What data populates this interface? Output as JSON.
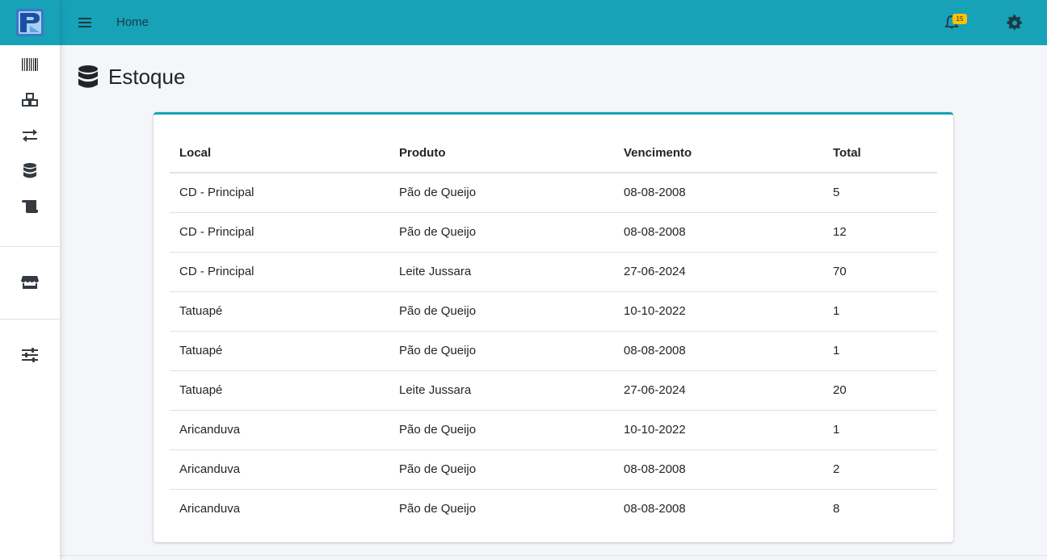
{
  "topbar": {
    "home_label": "Home",
    "notification_count": "15"
  },
  "page": {
    "title": "Estoque"
  },
  "table": {
    "headers": [
      "Local",
      "Produto",
      "Vencimento",
      "Total"
    ],
    "rows": [
      [
        "CD - Principal",
        "Pão de Queijo",
        "08-08-2008",
        "5"
      ],
      [
        "CD - Principal",
        "Pão de Queijo",
        "08-08-2008",
        "12"
      ],
      [
        "CD - Principal",
        "Leite Jussara",
        "27-06-2024",
        "70"
      ],
      [
        "Tatuapé",
        "Pão de Queijo",
        "10-10-2022",
        "1"
      ],
      [
        "Tatuapé",
        "Pão de Queijo",
        "08-08-2008",
        "1"
      ],
      [
        "Tatuapé",
        "Leite Jussara",
        "27-06-2024",
        "20"
      ],
      [
        "Aricanduva",
        "Pão de Queijo",
        "10-10-2022",
        "1"
      ],
      [
        "Aricanduva",
        "Pão de Queijo",
        "08-08-2008",
        "2"
      ],
      [
        "Aricanduva",
        "Pão de Queijo",
        "08-08-2008",
        "8"
      ]
    ]
  },
  "sidebar": {
    "icons": [
      "barcode-icon",
      "boxes-icon",
      "exchange-icon",
      "database-icon",
      "scroll-icon",
      "store-icon",
      "sliders-icon"
    ]
  },
  "colors": {
    "accent": "#17a2b8",
    "badge": "#ffc107"
  }
}
